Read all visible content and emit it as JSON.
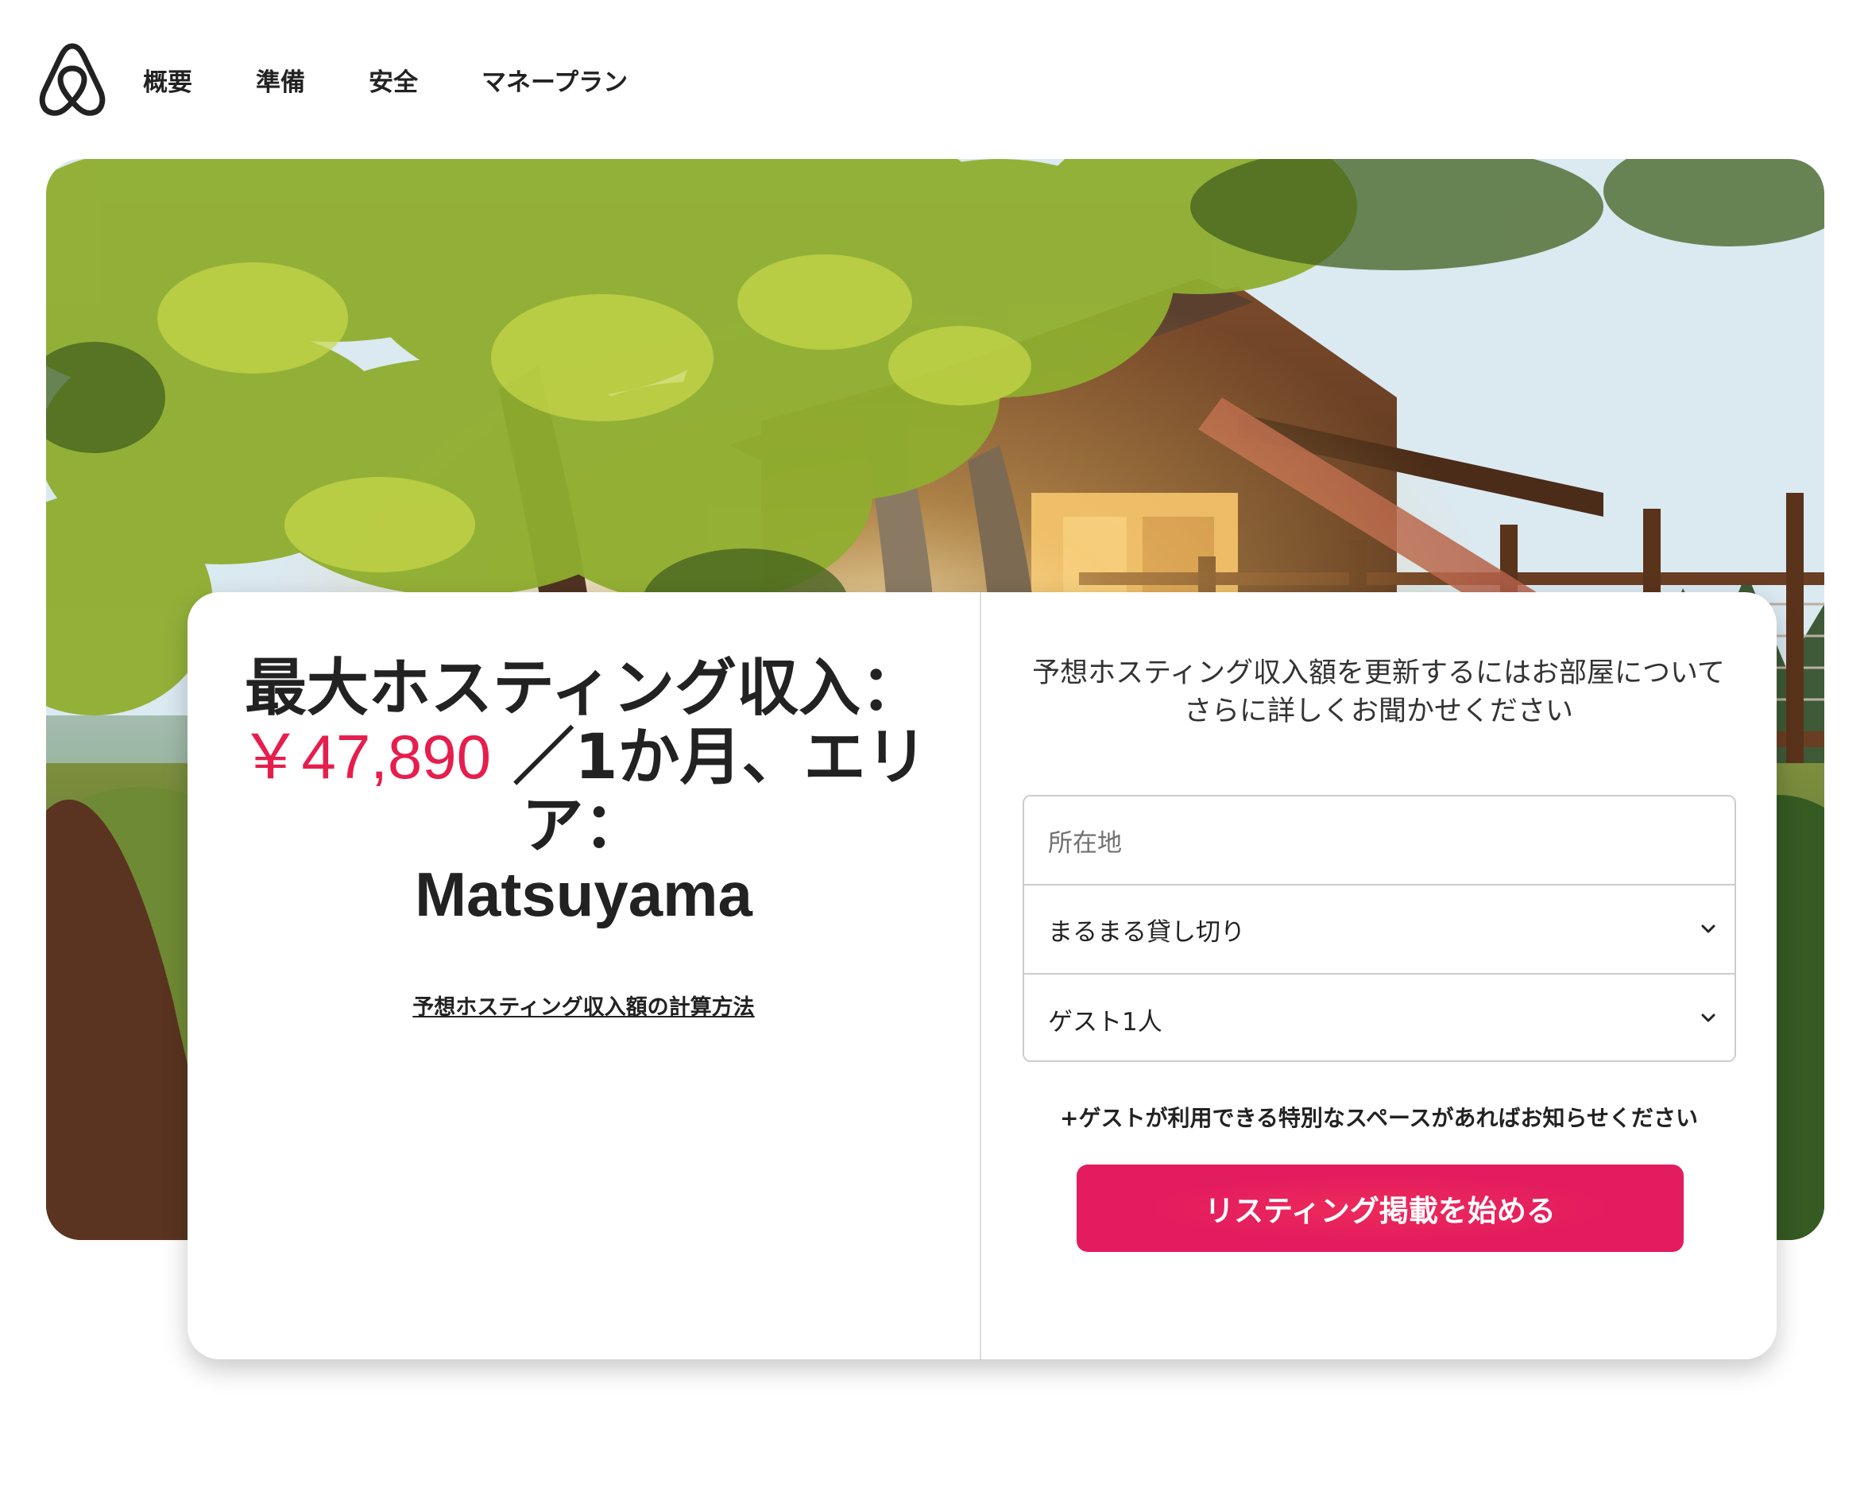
{
  "header": {
    "logo_icon": "airbnb-belo-icon",
    "nav": [
      {
        "label": "概要"
      },
      {
        "label": "準備"
      },
      {
        "label": "安全"
      },
      {
        "label": "マネープラン"
      }
    ]
  },
  "hero": {
    "image_description_icon": "treehouse-photo"
  },
  "earnings": {
    "headline_prefix": "最大ホスティング収入：",
    "amount": "￥47,890",
    "headline_period": " ／1か月、エリア：",
    "city": "Matsuyama",
    "calc_link": "予想ホスティング収入額の計算方法"
  },
  "form": {
    "prompt": "予想ホスティング収入額を更新するにはお部屋についてさらに詳しくお聞かせください",
    "location_placeholder": "所在地",
    "space_type": "まるまる貸し切り",
    "guests": "ゲスト1人",
    "special_space_link": "+ゲストが利用できる特別なスペースがあればお知らせください",
    "cta_label": "リスティング掲載を始める"
  },
  "colors": {
    "brand": "#e61e4d",
    "text": "#222222",
    "border": "#cccccc"
  }
}
